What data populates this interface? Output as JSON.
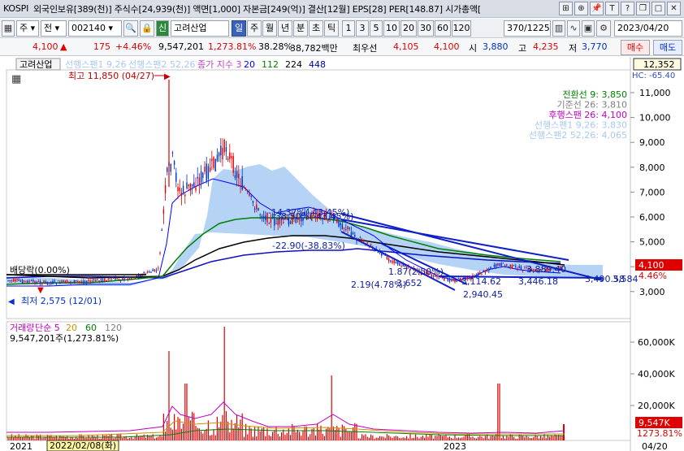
{
  "title_bar": {
    "market": "KOSPI",
    "info": "외국인보유[389(천)]  주식수[24,939(천)]  액면[1,000]  자본금[249(억)]  결산[12월]  EPS[28]  PER[148.87]  시가총액[",
    "icons": [
      "grid-icon",
      "crosshair-icon",
      "pin-icon",
      "text-icon",
      "help-icon",
      "restore-icon",
      "maximize-icon",
      "close-icon"
    ],
    "icon_glyphs": [
      "⊞",
      "⊕",
      "📌",
      "T",
      "?",
      "❐",
      "□",
      "✕"
    ]
  },
  "toolbar": {
    "market_select": "주",
    "market_select2": "전",
    "code": "002140",
    "search_glyph": "🔍",
    "lock_glyph": "🔒",
    "credit_badge": "신",
    "company": "고려산업",
    "periods": [
      "일",
      "주",
      "월",
      "년",
      "분",
      "초",
      "틱"
    ],
    "selected_period": "일",
    "intervals": [
      "1",
      "3",
      "5",
      "10",
      "20",
      "30",
      "60",
      "120"
    ],
    "count": "370",
    "total": "/1225",
    "date": "2023/04/20"
  },
  "price_bar": {
    "price": "4,100",
    "change_arrow": "▲",
    "change": "175",
    "change_pct": "+4.46%",
    "volume": "9,547,201",
    "volume_pct": "1,273.81%",
    "turnover": "38.28%",
    "amount": "38,782백만",
    "pref_label": "최우선",
    "ask": "4,105",
    "bid": "4,100",
    "open_label": "시",
    "open": "3,880",
    "high_label": "고",
    "high": "4,235",
    "low_label": "저",
    "low": "3,770",
    "buy_label": "매수",
    "sell_label": "매도"
  },
  "chart": {
    "company_tag": "고려산업",
    "legend_items": [
      {
        "text": "선행스팬1 9,26",
        "color": "#a8c8f0"
      },
      {
        "text": "선행스팬2 52,26",
        "color": "#a8c8f0"
      },
      {
        "text": "종가 지수 3",
        "color": "#c040c0"
      },
      {
        "text": "20",
        "color": "#0000ff"
      },
      {
        "text": "112",
        "color": "#008000"
      },
      {
        "text": "224",
        "color": "#000000"
      },
      {
        "text": "448",
        "color": "#0000a0"
      }
    ],
    "top_right_price": "12,352",
    "top_right_label": "HC: -65.40",
    "high_annotation": "최고 11,850 (04/27)",
    "low_annotation": "최저 2,575 (12/01)",
    "dividend_label": "배당락(0.00%)",
    "ichimoku_legend": [
      {
        "text": "전환선 9: 3,850",
        "color": "#008000"
      },
      {
        "text": "기준선 26: 3,810",
        "color": "#808080"
      },
      {
        "text": "후행스팬 26: 4,100",
        "color": "#c000c0"
      },
      {
        "text": "선행스팬1 9,26: 3,830",
        "color": "#a8c8f0"
      },
      {
        "text": "선행스팬2 52,26: 4,065",
        "color": "#a8c8f0"
      }
    ],
    "y_axis_labels": [
      "11,000",
      "10,000",
      "9,000",
      "8,000",
      "7,000",
      "6,000",
      "5,000",
      "4,000",
      "3,000"
    ],
    "current_price_tag": "4,100",
    "current_pct_tag": "4.46%",
    "trend_labels": [
      "-14,37%(-43.45%)",
      "-38,50%(-43.45%)",
      "-22.90(-38.83%)",
      "1.87(2.50%)",
      "2.19(4.78%)",
      "3.652",
      "2,940.45",
      "3,114.62",
      "3,889.40",
      "3,446.18",
      "3,490.58",
      "3,584"
    ],
    "volume_legend": [
      {
        "text": "거래량",
        "color": "#c000c0"
      },
      {
        "text": "단순 5",
        "color": "#c000c0"
      },
      {
        "text": "20",
        "color": "#d09000"
      },
      {
        "text": "60",
        "color": "#008000"
      },
      {
        "text": "120",
        "color": "#808080"
      }
    ],
    "volume_value": "9,547,201주(1,273.81%)",
    "volume_axis_labels": [
      "60,000K",
      "40,000K",
      "20,000K"
    ],
    "volume_tag": "9,547K",
    "volume_pct_tag": "1273.81%",
    "x_axis_labels": [
      "2021",
      "2023",
      "04/20"
    ],
    "x_cursor_label": "2022/02/08(화)"
  }
}
